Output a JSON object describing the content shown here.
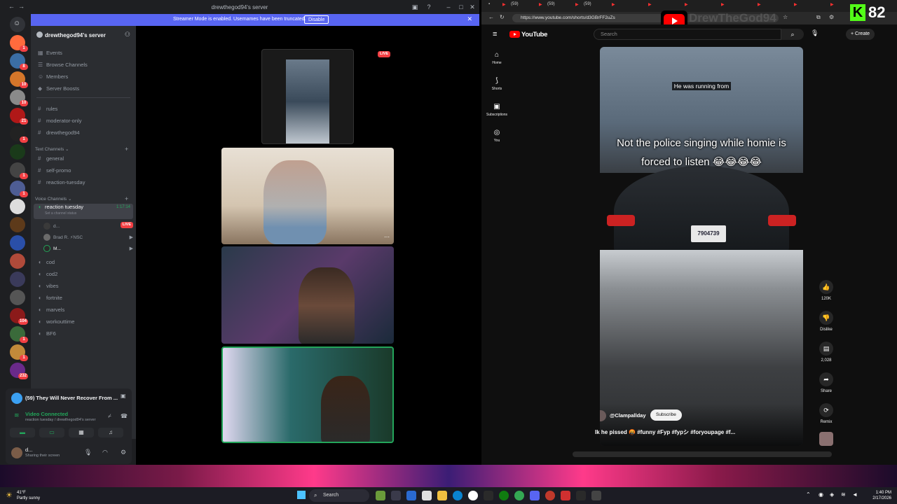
{
  "discord": {
    "window_title": "drewthegod94's server",
    "streamer_banner": {
      "message": "Streamer Mode is enabled. Usernames have been truncated.",
      "disable_label": "Disable"
    },
    "server_name": "drewthegod94's server",
    "top_items": [
      {
        "label": "Events",
        "icon": "calendar-icon"
      },
      {
        "label": "Browse Channels",
        "icon": "browse-icon"
      },
      {
        "label": "Members",
        "icon": "members-icon"
      },
      {
        "label": "Server Boosts",
        "icon": "boost-icon"
      }
    ],
    "pinned_channels": [
      "rules",
      "moderator-only",
      "drewthegod94"
    ],
    "text_category": "Text Channels",
    "text_channels": [
      "general",
      "self-promo",
      "reaction-tuesday"
    ],
    "voice_category": "Voice Channels",
    "active_voice": {
      "name": "reaction tuesday",
      "timer": "1:17:14",
      "status": "Set a channel status"
    },
    "voice_users": [
      {
        "name": "d...",
        "live": "LIVE"
      },
      {
        "name": "Brad R. ⚡NSC",
        "live": ""
      },
      {
        "name": "M...",
        "live": ""
      }
    ],
    "voice_channels": [
      "cod",
      "cod2",
      "vibes",
      "fortnite",
      "marvels",
      "workouttime",
      "BF6"
    ],
    "guild_badges": [
      "1",
      "8",
      "10",
      "10",
      "21",
      "1",
      "1",
      "1",
      "104",
      "1",
      "1",
      "232"
    ],
    "now_playing": "(59) They Will Never Recover From ...",
    "voice_connected": "Video Connected",
    "voice_connected_sub": "reaction tuesday / drewthegod94's server",
    "me": {
      "name": "d...",
      "status": "Sharing their screen"
    },
    "stage_live": "LIVE"
  },
  "browser": {
    "url": "https://www.youtube.com/shorts/d3GBrFF2uZs",
    "tab_label": "(59)"
  },
  "youtube": {
    "brand": "YouTube",
    "search_placeholder": "Search",
    "create_label": "Create",
    "nav": [
      "Home",
      "Shorts",
      "Subscriptions",
      "You"
    ],
    "caption_top": "He was running from",
    "caption_main_line1": "Not the police singing while homie is",
    "caption_main_line2": "forced to listen 😂😂😂😂",
    "plate": "7904739",
    "channel": "@Clampallday",
    "subscribe_label": "Subscribe",
    "description": "Ik he pissed 🤬 #funny #Fyp #fypシ #foryoupage #f...",
    "actions": [
      {
        "label": "120K",
        "icon": "like-icon"
      },
      {
        "label": "Dislike",
        "icon": "dislike-icon"
      },
      {
        "label": "2,028",
        "icon": "comment-icon"
      },
      {
        "label": "Share",
        "icon": "share-icon"
      },
      {
        "label": "Remix",
        "icon": "remix-icon"
      }
    ],
    "watermark": "DrewTheGod94"
  },
  "overlay": {
    "viewer_count": "82",
    "kick_letter": "K"
  },
  "taskbar": {
    "temperature": "41°F",
    "weather": "Partly sunny",
    "search_label": "Search",
    "time": "1:40 PM",
    "date": "2/17/2026"
  }
}
